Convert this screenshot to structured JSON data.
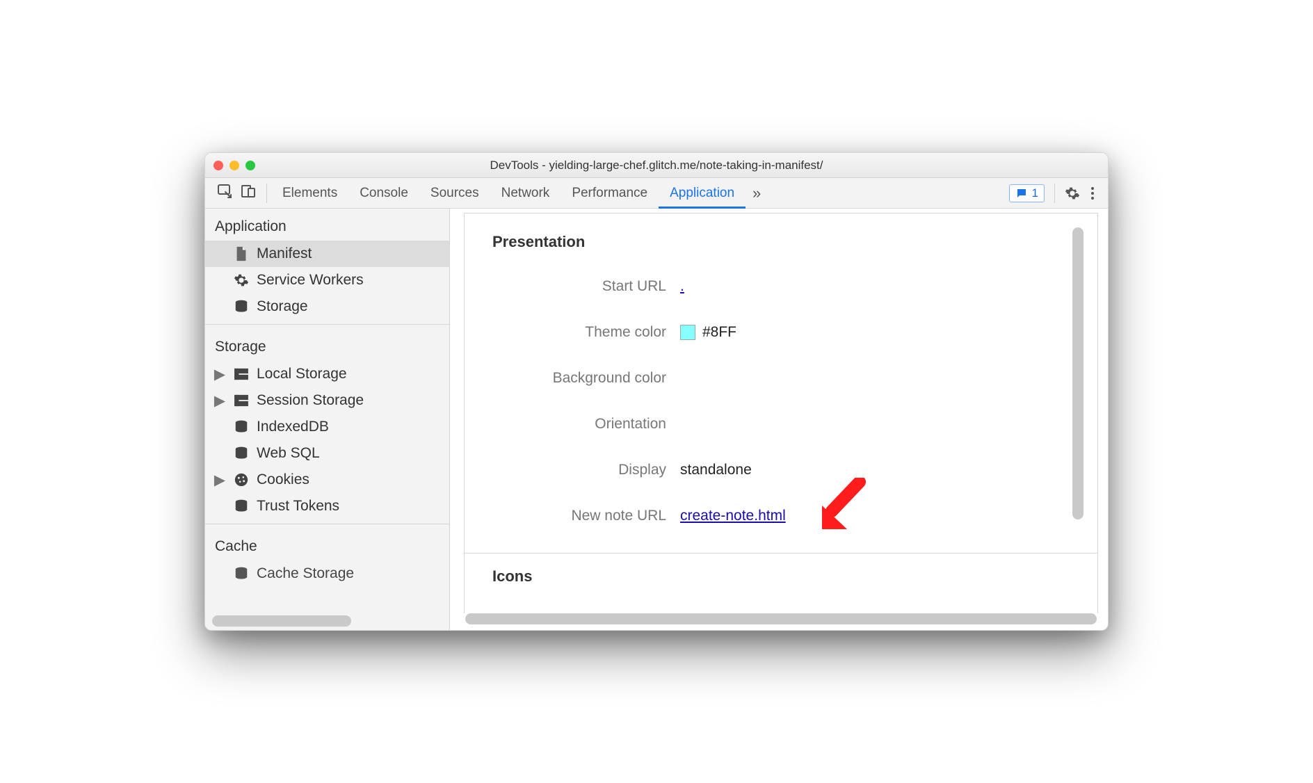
{
  "window": {
    "title": "DevTools - yielding-large-chef.glitch.me/note-taking-in-manifest/"
  },
  "toolbar": {
    "tabs": [
      "Elements",
      "Console",
      "Sources",
      "Network",
      "Performance",
      "Application"
    ],
    "active_tab": 5,
    "error_count": "1"
  },
  "sidebar": {
    "groups": [
      {
        "title": "Application",
        "items": [
          {
            "label": "Manifest",
            "icon": "file",
            "selected": true
          },
          {
            "label": "Service Workers",
            "icon": "gear"
          },
          {
            "label": "Storage",
            "icon": "db"
          }
        ]
      },
      {
        "title": "Storage",
        "items": [
          {
            "label": "Local Storage",
            "icon": "table",
            "expandable": true
          },
          {
            "label": "Session Storage",
            "icon": "table",
            "expandable": true
          },
          {
            "label": "IndexedDB",
            "icon": "db"
          },
          {
            "label": "Web SQL",
            "icon": "db"
          },
          {
            "label": "Cookies",
            "icon": "cookie",
            "expandable": true
          },
          {
            "label": "Trust Tokens",
            "icon": "db"
          }
        ]
      },
      {
        "title": "Cache",
        "items": [
          {
            "label": "Cache Storage",
            "icon": "db"
          }
        ]
      }
    ]
  },
  "main": {
    "section1": "Presentation",
    "section2": "Icons",
    "rows": {
      "start_url": {
        "label": "Start URL",
        "value": "."
      },
      "theme_color": {
        "label": "Theme color",
        "value": "#8FF",
        "swatch": "#88FFFF"
      },
      "background_color": {
        "label": "Background color",
        "value": ""
      },
      "orientation": {
        "label": "Orientation",
        "value": ""
      },
      "display": {
        "label": "Display",
        "value": "standalone"
      },
      "new_note_url": {
        "label": "New note URL",
        "value": "create-note.html"
      }
    }
  }
}
